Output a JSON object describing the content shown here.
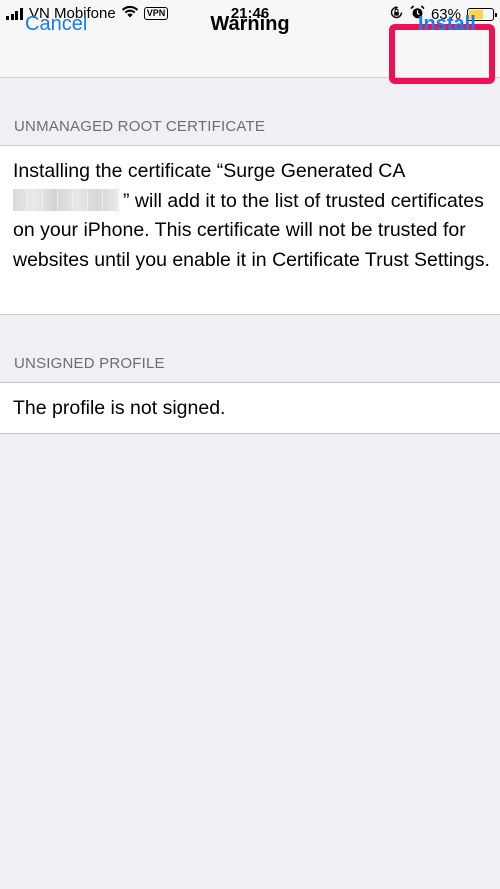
{
  "status_bar": {
    "carrier": "VN Mobifone",
    "vpn": "VPN",
    "time": "21:46",
    "battery": "63%",
    "battery_level": 0.63,
    "icons": [
      "signal-icon",
      "wifi-icon",
      "vpn-badge",
      "orientation-lock-icon",
      "alarm-icon",
      "battery-icon"
    ]
  },
  "nav": {
    "cancel": "Cancel",
    "title": "Warning",
    "install": "Install",
    "highlight_color": "#ef0f55"
  },
  "sections": {
    "root_cert": {
      "header": "UNMANAGED ROOT CERTIFICATE",
      "text_before": "Installing the certificate “Surge Generated CA",
      "text_after": "” will add it to the list of trusted certificates on your iPhone. This certificate will not be trusted for websites until you enable it in Certificate Trust Settings."
    },
    "unsigned": {
      "header": "UNSIGNED PROFILE",
      "text": "The profile is not signed."
    }
  },
  "colors": {
    "accent": "#1a7cf0",
    "background": "#efeff4",
    "header_text": "#6d6d72"
  }
}
